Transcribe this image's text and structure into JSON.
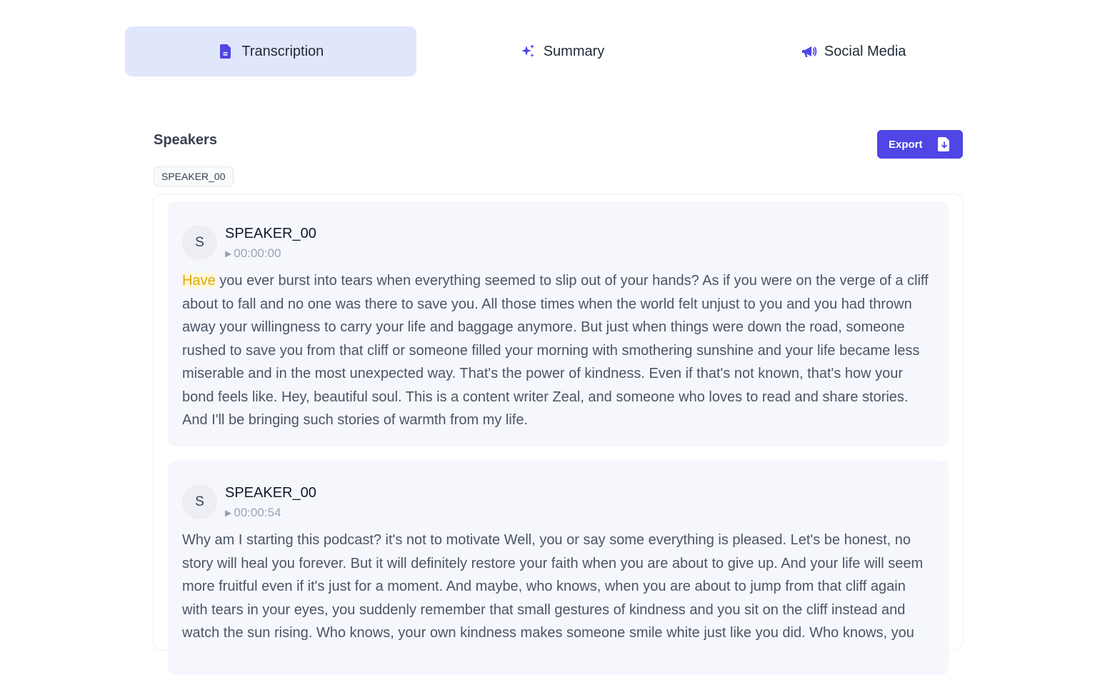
{
  "tabs": [
    {
      "label": "Transcription",
      "icon": "document-icon",
      "active": true
    },
    {
      "label": "Summary",
      "icon": "sparkles-icon",
      "active": false
    },
    {
      "label": "Social Media",
      "icon": "megaphone-icon",
      "active": false
    }
  ],
  "speakers": {
    "title": "Speakers",
    "chips": [
      "SPEAKER_00"
    ]
  },
  "export": {
    "label": "Export",
    "icon": "file-download-icon"
  },
  "colors": {
    "accent": "#4f46e5",
    "active_tab_bg": "#e0e7fd",
    "segment_bg": "#f5f7fd",
    "highlight": "#e0a800"
  },
  "segments": [
    {
      "avatar": "S",
      "speaker": "SPEAKER_00",
      "time": "00:00:00",
      "highlight_word": "Have",
      "text": " you ever burst into tears when everything seemed to slip out of your hands? As if you were on the verge of a cliff about to fall and no one was there to save you. All those times when the world felt unjust to you and you had thrown away your willingness to carry your life and baggage anymore. But just when things were down the road, someone rushed to save you from that cliff or someone filled your morning with smothering sunshine and your life became less miserable and in the most unexpected way. That's the power of kindness. Even if that's not known, that's how your bond feels like. Hey, beautiful soul. This is a content writer Zeal, and someone who loves to read and share stories. And I'll be bringing such stories of warmth from my life."
    },
    {
      "avatar": "S",
      "speaker": "SPEAKER_00",
      "time": "00:00:54",
      "text": "Why am I starting this podcast? it's not to motivate Well, you or say some everything is pleased. Let's be honest, no story will heal you forever. But it will definitely restore your faith when you are about to give up. And your life will seem more fruitful even if it's just for a moment. And maybe, who knows, when you are about to jump from that cliff again with tears in your eyes, you suddenly remember that small gestures of kindness and you sit on the cliff instead and watch the sun rising. Who knows, your own kindness makes someone smile white just like you did. Who knows, you"
    }
  ]
}
